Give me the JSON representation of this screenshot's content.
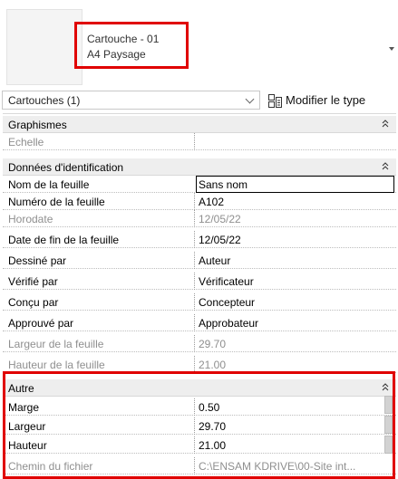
{
  "type_selector": {
    "family": "Cartouche - 01",
    "type": "A4 Paysage"
  },
  "filter": {
    "selected": "Cartouches (1)",
    "edit_type_label": "Modifier le type"
  },
  "groups": {
    "graphismes": "Graphismes",
    "identification": "Données d'identification",
    "autre": "Autre"
  },
  "rows": {
    "echelle": {
      "name": "Echelle",
      "value": ""
    },
    "nom_feuille": {
      "name": "Nom de la feuille",
      "value": "Sans nom"
    },
    "numero": {
      "name": "Numéro de la feuille",
      "value": "A102"
    },
    "horodate": {
      "name": "Horodate",
      "value": "12/05/22"
    },
    "date_fin": {
      "name": "Date de fin de la feuille",
      "value": "12/05/22"
    },
    "dessine": {
      "name": "Dessiné par",
      "value": "Auteur"
    },
    "verifie": {
      "name": "Vérifié par",
      "value": "Vérificateur"
    },
    "concu": {
      "name": "Conçu par",
      "value": "Concepteur"
    },
    "approuve": {
      "name": "Approuvé par",
      "value": "Approbateur"
    },
    "largeur_feuille": {
      "name": "Largeur de la feuille",
      "value": "29.70"
    },
    "hauteur_feuille": {
      "name": "Hauteur de la feuille",
      "value": "21.00"
    },
    "marge": {
      "name": "Marge",
      "value": "0.50"
    },
    "largeur": {
      "name": "Largeur",
      "value": "29.70"
    },
    "hauteur": {
      "name": "Hauteur",
      "value": "21.00"
    },
    "chemin": {
      "name": "Chemin du fichier",
      "value": "C:\\ENSAM KDRIVE\\00-Site int..."
    }
  },
  "colors": {
    "highlight": "#e00000",
    "group_bg": "#eeeeee",
    "readonly_text": "#8f8f8f"
  }
}
